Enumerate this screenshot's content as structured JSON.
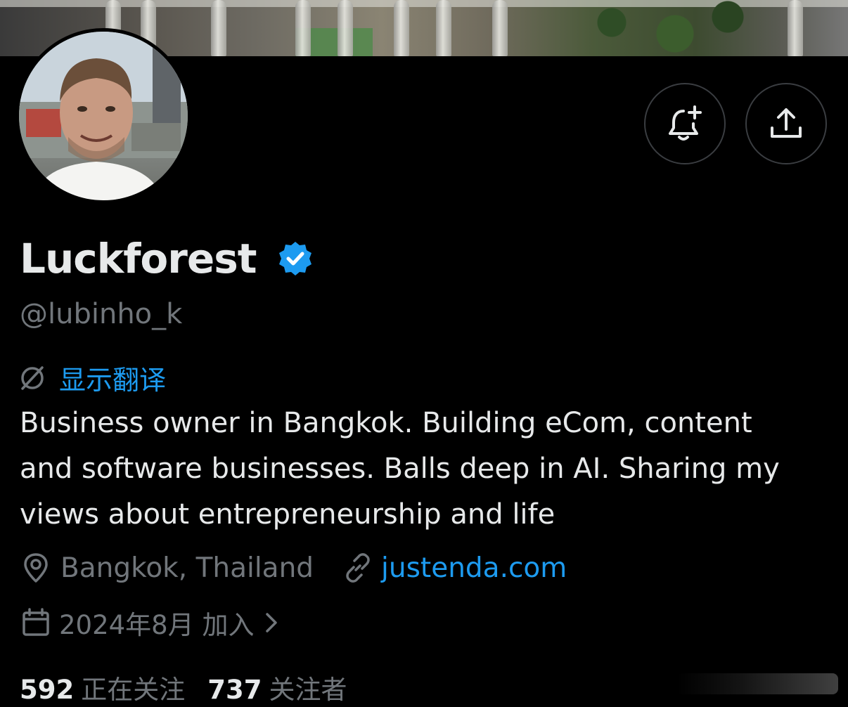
{
  "profile": {
    "display_name": "Luckforest",
    "handle": "@lubinho_k",
    "verified": true,
    "translate_label": "显示翻译",
    "bio_lines": [
      "Business owner in Bangkok. Building eCom, content",
      "and software businesses. Balls deep in AI. Sharing my",
      "views about entrepreneurship and life"
    ],
    "location": "Bangkok, Thailand",
    "website": "justenda.com",
    "joined": "2024年8月 加入",
    "following_count": "592",
    "following_label": "正在关注",
    "followers_count": "737",
    "followers_label": "关注者"
  },
  "icons": {
    "notify": "bell-plus-icon",
    "share": "share-upload-icon",
    "translate": "translate-slash-icon",
    "location": "location-pin-icon",
    "link": "link-icon",
    "calendar": "calendar-icon",
    "chevron": "chevron-right-icon",
    "verified": "verified-badge-icon"
  },
  "colors": {
    "background": "#000000",
    "text_primary": "#e7e9ea",
    "text_secondary": "#71767b",
    "accent": "#1d9bf0",
    "border": "#3a3d41"
  }
}
